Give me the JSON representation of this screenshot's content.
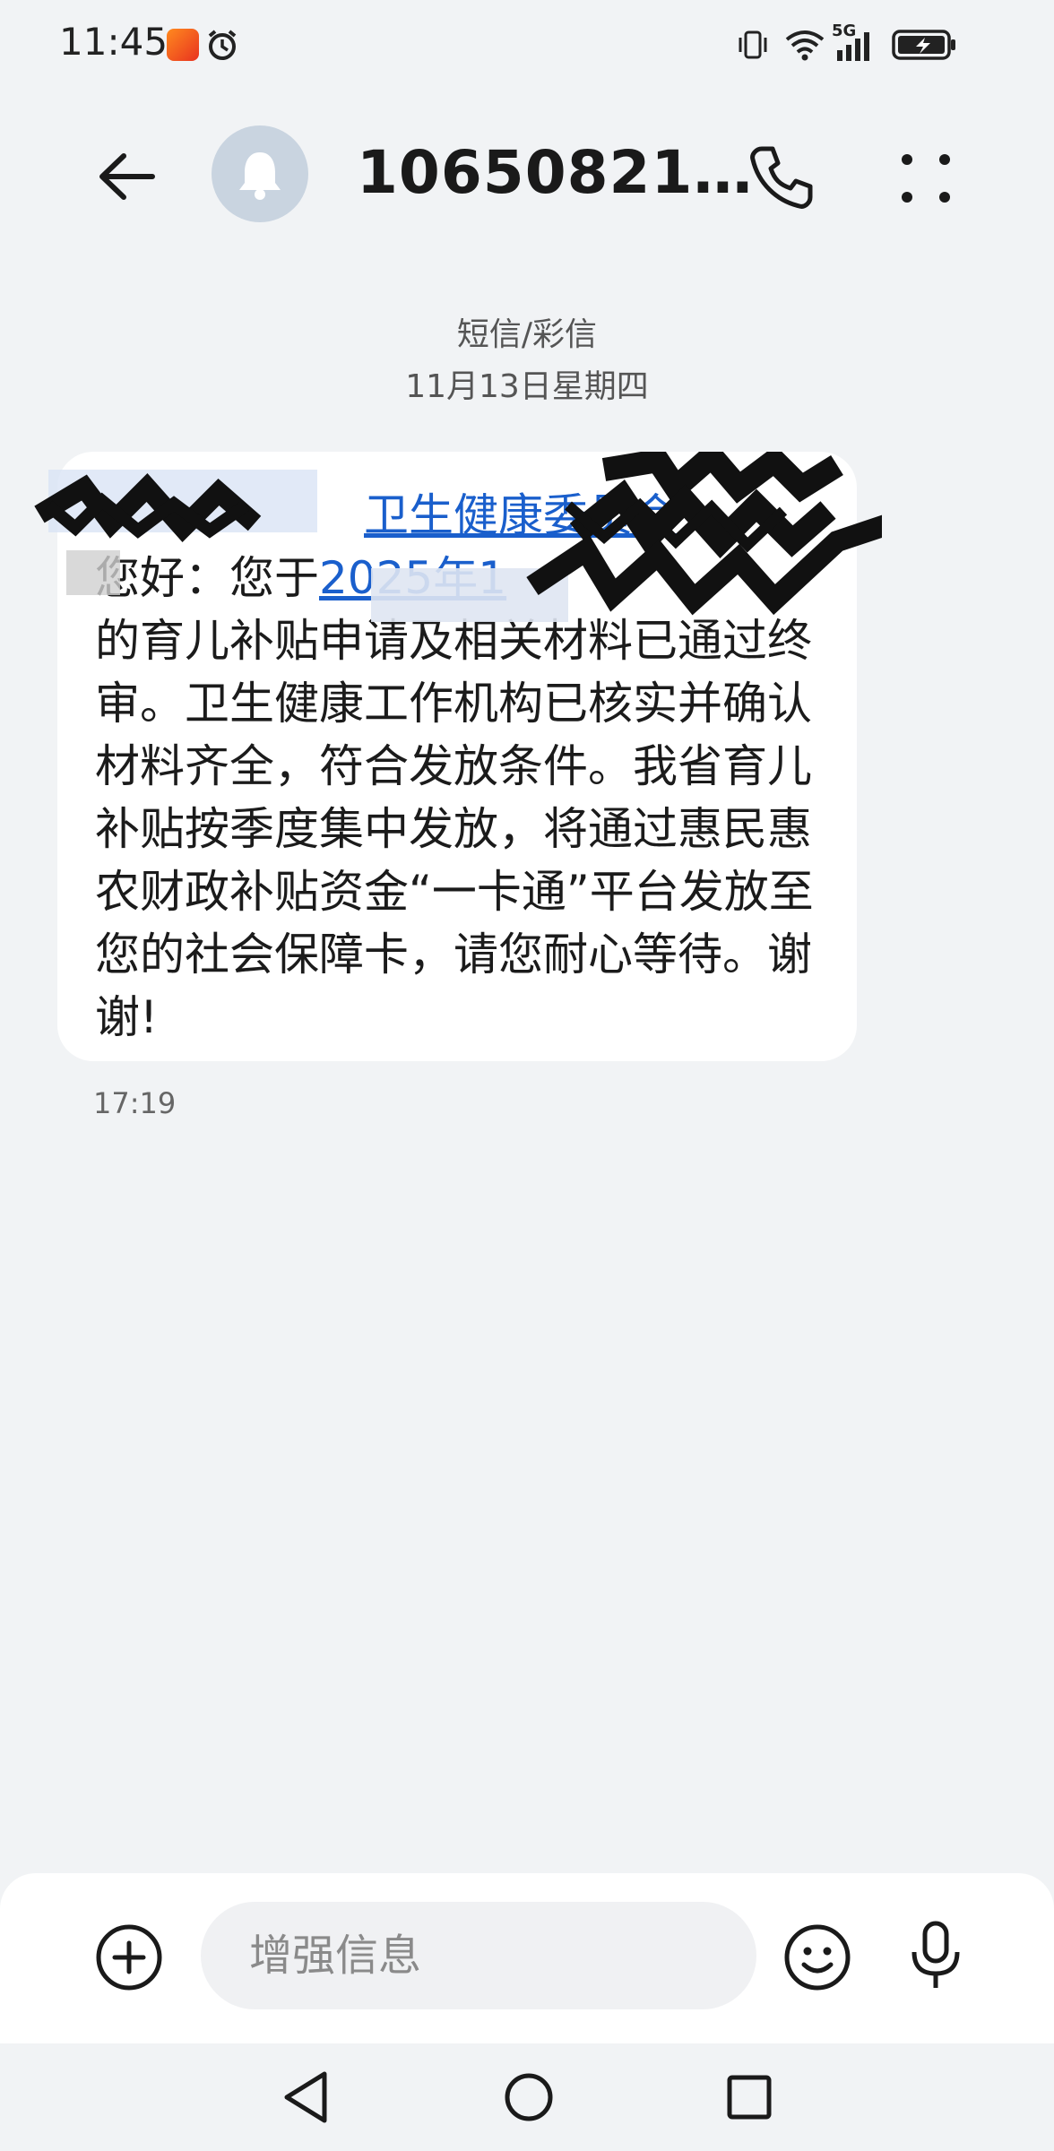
{
  "status_bar": {
    "time": "11:45",
    "icons": [
      "app-notification-icon",
      "alarm-icon",
      "vibrate-icon",
      "wifi-icon",
      "signal-5g-icon",
      "battery-charging-icon"
    ],
    "network_label": "5G"
  },
  "header": {
    "contact_title": "10650821…",
    "icons": [
      "back-arrow-icon",
      "bell-icon",
      "phone-icon",
      "more-icon"
    ]
  },
  "thread": {
    "type_label": "短信/彩信",
    "date_label": "11月13日星期四",
    "message": {
      "line1_visible": "卫生健康委员会",
      "line2_prefix": "您好：您于",
      "line2_link": "2025年1",
      "body": "的育儿补贴申请及相关材料已通过终审。卫生健康工作机构已核实并确认材料齐全，符合发放条件。我省育儿补贴按季度集中发放，将通过惠民惠农财政补贴资金“一卡通”平台发放至您的社会保障卡，请您耐心等待。谢谢!",
      "time": "17:19"
    }
  },
  "compose": {
    "placeholder": "增强信息",
    "icons": [
      "add-icon",
      "emoji-icon",
      "microphone-icon"
    ]
  },
  "colors": {
    "background": "#f1f3f5",
    "bubble": "#ffffff",
    "link": "#1a5fcc",
    "avatar": "#c9d4e0"
  }
}
